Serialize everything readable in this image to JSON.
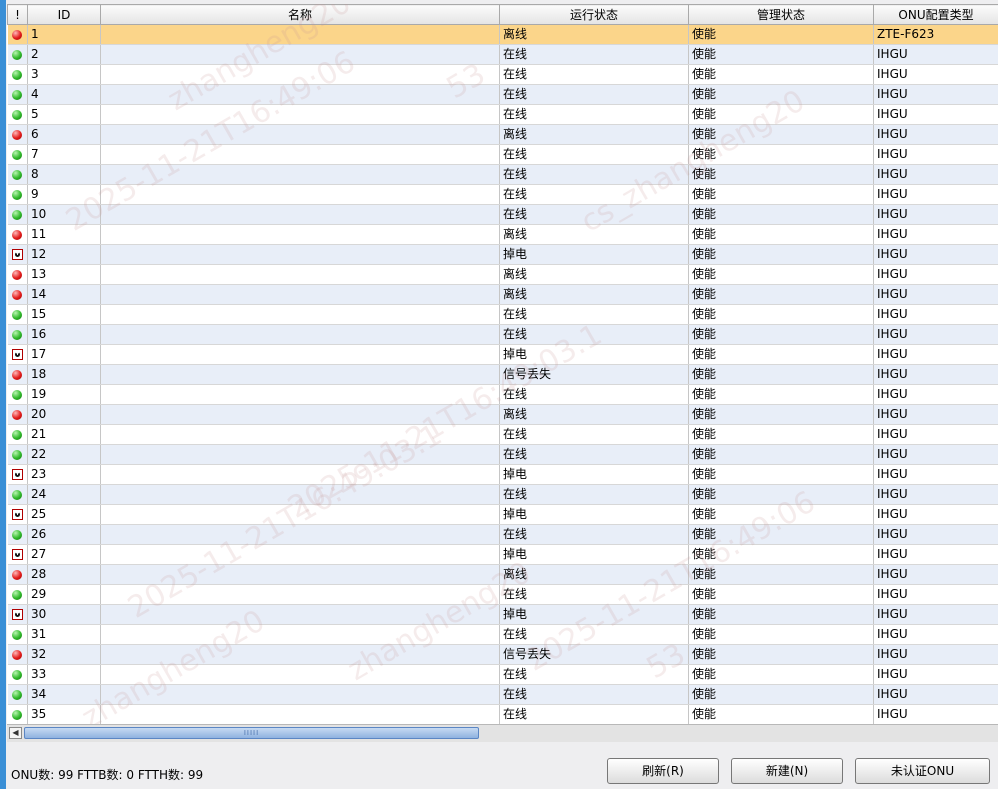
{
  "columns": [
    "!",
    "ID",
    "名称",
    "运行状态",
    "管理状态",
    "ONU配置类型"
  ],
  "rows": [
    {
      "icon": "red",
      "id": "1",
      "name": "",
      "run": "离线",
      "admin": "使能",
      "type": "ZTE-F623",
      "selected": true
    },
    {
      "icon": "green",
      "id": "2",
      "name": "",
      "run": "在线",
      "admin": "使能",
      "type": "IHGU"
    },
    {
      "icon": "green",
      "id": "3",
      "name": "",
      "run": "在线",
      "admin": "使能",
      "type": "IHGU"
    },
    {
      "icon": "green",
      "id": "4",
      "name": "",
      "run": "在线",
      "admin": "使能",
      "type": "IHGU"
    },
    {
      "icon": "green",
      "id": "5",
      "name": "",
      "run": "在线",
      "admin": "使能",
      "type": "IHGU"
    },
    {
      "icon": "red",
      "id": "6",
      "name": "",
      "run": "离线",
      "admin": "使能",
      "type": "IHGU"
    },
    {
      "icon": "green",
      "id": "7",
      "name": "",
      "run": "在线",
      "admin": "使能",
      "type": "IHGU"
    },
    {
      "icon": "green",
      "id": "8",
      "name": "",
      "run": "在线",
      "admin": "使能",
      "type": "IHGU"
    },
    {
      "icon": "green",
      "id": "9",
      "name": "",
      "run": "在线",
      "admin": "使能",
      "type": "IHGU"
    },
    {
      "icon": "green",
      "id": "10",
      "name": "",
      "run": "在线",
      "admin": "使能",
      "type": "IHGU"
    },
    {
      "icon": "red",
      "id": "11",
      "name": "",
      "run": "离线",
      "admin": "使能",
      "type": "IHGU"
    },
    {
      "icon": "power",
      "id": "12",
      "name": "",
      "run": "掉电",
      "admin": "使能",
      "type": "IHGU"
    },
    {
      "icon": "red",
      "id": "13",
      "name": "",
      "run": "离线",
      "admin": "使能",
      "type": "IHGU"
    },
    {
      "icon": "red",
      "id": "14",
      "name": "",
      "run": "离线",
      "admin": "使能",
      "type": "IHGU"
    },
    {
      "icon": "green",
      "id": "15",
      "name": "",
      "run": "在线",
      "admin": "使能",
      "type": "IHGU"
    },
    {
      "icon": "green",
      "id": "16",
      "name": "",
      "run": "在线",
      "admin": "使能",
      "type": "IHGU"
    },
    {
      "icon": "power",
      "id": "17",
      "name": "",
      "run": "掉电",
      "admin": "使能",
      "type": "IHGU"
    },
    {
      "icon": "red",
      "id": "18",
      "name": "",
      "run": "信号丢失",
      "admin": "使能",
      "type": "IHGU"
    },
    {
      "icon": "green",
      "id": "19",
      "name": "",
      "run": "在线",
      "admin": "使能",
      "type": "IHGU"
    },
    {
      "icon": "red",
      "id": "20",
      "name": "",
      "run": "离线",
      "admin": "使能",
      "type": "IHGU"
    },
    {
      "icon": "green",
      "id": "21",
      "name": "",
      "run": "在线",
      "admin": "使能",
      "type": "IHGU"
    },
    {
      "icon": "green",
      "id": "22",
      "name": "",
      "run": "在线",
      "admin": "使能",
      "type": "IHGU"
    },
    {
      "icon": "power",
      "id": "23",
      "name": "",
      "run": "掉电",
      "admin": "使能",
      "type": "IHGU"
    },
    {
      "icon": "green",
      "id": "24",
      "name": "",
      "run": "在线",
      "admin": "使能",
      "type": "IHGU"
    },
    {
      "icon": "power",
      "id": "25",
      "name": "",
      "run": "掉电",
      "admin": "使能",
      "type": "IHGU"
    },
    {
      "icon": "green",
      "id": "26",
      "name": "",
      "run": "在线",
      "admin": "使能",
      "type": "IHGU"
    },
    {
      "icon": "power",
      "id": "27",
      "name": "",
      "run": "掉电",
      "admin": "使能",
      "type": "IHGU"
    },
    {
      "icon": "red",
      "id": "28",
      "name": "",
      "run": "离线",
      "admin": "使能",
      "type": "IHGU"
    },
    {
      "icon": "green",
      "id": "29",
      "name": "",
      "run": "在线",
      "admin": "使能",
      "type": "IHGU"
    },
    {
      "icon": "power",
      "id": "30",
      "name": "",
      "run": "掉电",
      "admin": "使能",
      "type": "IHGU"
    },
    {
      "icon": "green",
      "id": "31",
      "name": "",
      "run": "在线",
      "admin": "使能",
      "type": "IHGU"
    },
    {
      "icon": "red",
      "id": "32",
      "name": "",
      "run": "信号丢失",
      "admin": "使能",
      "type": "IHGU"
    },
    {
      "icon": "green",
      "id": "33",
      "name": "",
      "run": "在线",
      "admin": "使能",
      "type": "IHGU"
    },
    {
      "icon": "green",
      "id": "34",
      "name": "",
      "run": "在线",
      "admin": "使能",
      "type": "IHGU"
    },
    {
      "icon": "green",
      "id": "35",
      "name": "",
      "run": "在线",
      "admin": "使能",
      "type": "IHGU"
    }
  ],
  "icons": {
    "red": "offline-status-icon",
    "green": "online-status-icon",
    "power": "power-off-icon"
  },
  "colors": {
    "selected_row": "#fbd58a",
    "alt_row": "#e8eef8",
    "online": "#2fb82a",
    "offline": "#e21b1b"
  },
  "status": {
    "text": "ONU数: 99   FTTB数: 0   FTTH数: 99"
  },
  "buttons": {
    "refresh": "刷新(R)",
    "new": "新建(N)",
    "unauth": "未认证ONU"
  },
  "scrollbar": {
    "grip": "IIIII"
  },
  "watermarks": [
    "zhangheng20",
    "2025-11-21T16:49:06",
    "53",
    "cs_zhangheng20",
    "2025-11-21T16:49:03.1"
  ]
}
